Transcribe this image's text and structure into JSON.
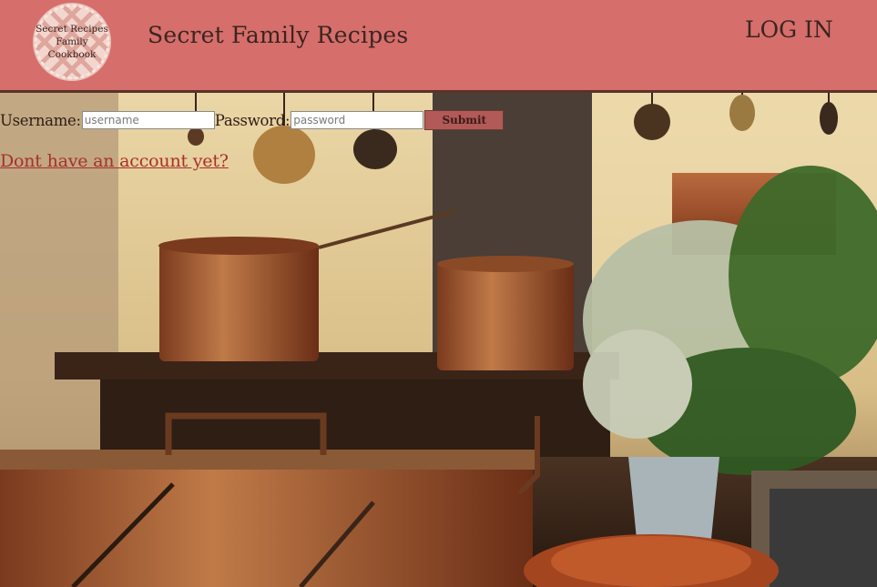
{
  "header": {
    "logo_text": [
      "Secret Recipes",
      "Family",
      "Cookbook"
    ],
    "site_title": "Secret Family Recipes",
    "login_link": "LOG IN"
  },
  "login_form": {
    "username_label": "Username:",
    "username_placeholder": "username",
    "password_label": "Password:",
    "password_placeholder": "password",
    "submit_label": "Submit"
  },
  "signup_link": "Dont have an account yet?",
  "colors": {
    "header_bg": "#d66e6b",
    "header_border": "#5a3227",
    "submit_bg": "#b25a57",
    "link_color": "#a8302c"
  },
  "hero_image": "kitchen-copper-pots-photo"
}
